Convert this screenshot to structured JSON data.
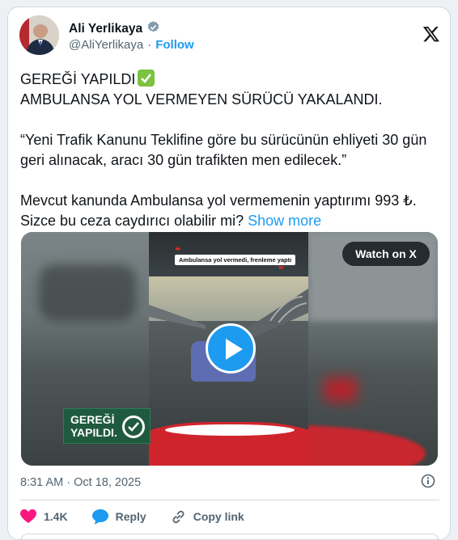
{
  "author": {
    "name": "Ali Yerlikaya",
    "handle": "@AliYerlikaya",
    "separator": "·",
    "follow_label": "Follow",
    "verified_icon": "verified-badge-icon",
    "brand_logo": "x-logo-icon"
  },
  "tweet": {
    "line1": "GEREĞİ YAPILDI",
    "line1_emoji": "check-mark-button-icon",
    "line2": "AMBULANSA YOL VERMEYEN SÜRÜCÜ YAKALANDI.",
    "quote": "“Yeni Trafik Kanunu Teklifine göre bu sürücünün ehliyeti 30 gün geri alınacak, aracı 30 gün trafikten men edilecek.”",
    "text3": "Mevcut kanunda Ambulansa yol vermemenin yaptırımı 993 ₺. Sizce bu ceza caydırıcı olabilir mi?",
    "show_more": "Show more"
  },
  "media": {
    "caption": "Ambulansa yol vermedi, frenleme yaptı",
    "watch_label": "Watch on X",
    "badge_line1": "GEREĞİ",
    "badge_line2": "YAPILDI.",
    "play_icon": "play-icon"
  },
  "meta": {
    "time": "8:31 AM",
    "separator": "·",
    "date": "Oct 18, 2025",
    "info_icon": "info-icon"
  },
  "actions": {
    "like_count": "1.4K",
    "reply_label": "Reply",
    "copy_label": "Copy link"
  },
  "colors": {
    "accent": "#1d9bf0",
    "like": "#f91880",
    "text": "#0f1419",
    "muted": "#536471"
  }
}
